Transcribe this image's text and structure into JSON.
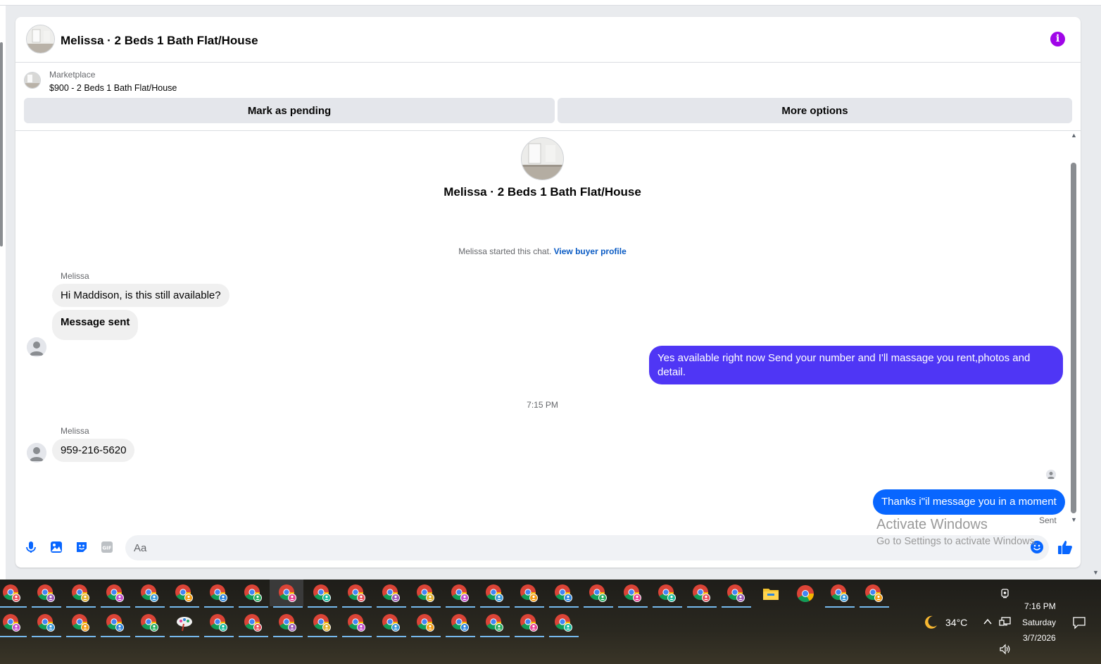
{
  "header": {
    "title": "Melissa · 2 Beds 1 Bath Flat/House",
    "info_icon": "i"
  },
  "listing": {
    "source": "Marketplace",
    "title": "$900 - 2 Beds 1 Bath Flat/House",
    "mark_pending_label": "Mark as pending",
    "more_options_label": "More options"
  },
  "conversation": {
    "title": "Melissa · 2 Beds 1 Bath Flat/House",
    "started_text": "Melissa started this chat.",
    "view_profile_link": "View buyer profile",
    "messages": [
      {
        "sender": "Melissa",
        "text": "Hi Maddison, is this still available?",
        "direction": "in"
      },
      {
        "text": "Message sent",
        "direction": "in"
      },
      {
        "text": "Yes available right now Send your number and I'll massage you rent,photos and detail.",
        "direction": "out"
      },
      {
        "sender": "Melissa",
        "text": "959-216-5620",
        "direction": "in"
      },
      {
        "text": "Thanks i\"il message you in a moment",
        "direction": "out"
      }
    ],
    "timestamp": "7:15 PM",
    "sent_status": "Sent"
  },
  "composer": {
    "placeholder": "Aa",
    "icons": [
      "microphone-icon",
      "photo-icon",
      "sticker-icon",
      "gif-icon",
      "emoji-icon",
      "thumbs-up-icon"
    ]
  },
  "watermark": {
    "line1": "Activate Windows",
    "line2": "Go to Settings to activate Windows."
  },
  "taskbar": {
    "weather": "34°C",
    "time": "7:16 PM",
    "day": "Saturday",
    "date": "3/7/2026"
  },
  "colors": {
    "outgoing_bubble": "#0866ff",
    "outgoing_bubble_alt": "#4f36f5",
    "incoming_bubble": "#f0f0f0",
    "accent": "#0a5bc4",
    "info": "#a005e8"
  }
}
